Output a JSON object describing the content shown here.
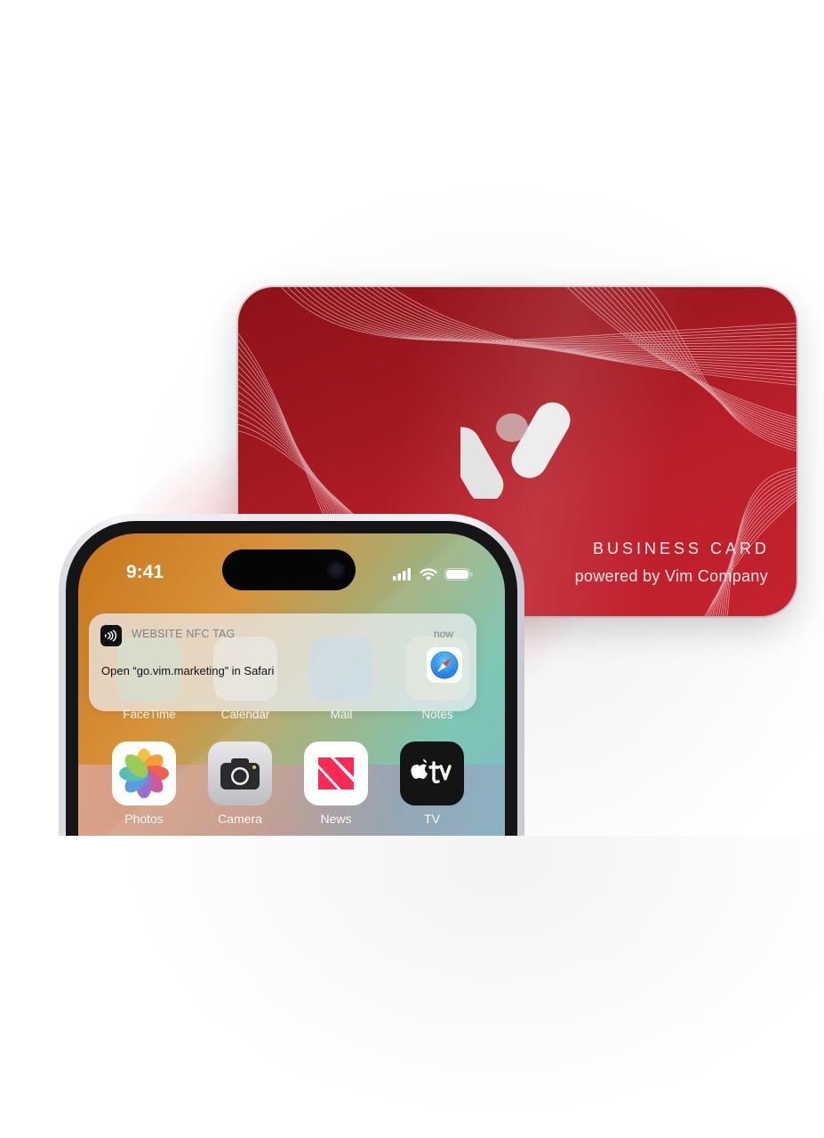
{
  "card": {
    "title": "BUSINESS CARD",
    "subtitle": "powered by Vim Company",
    "colors": {
      "base": "#a51a23",
      "logo": "#e0e0e0"
    }
  },
  "phone": {
    "status": {
      "time": "9:41"
    },
    "notification": {
      "app_name": "WEBSITE NFC TAG",
      "time": "now",
      "message": "Open “go.vim.marketing” in Safari",
      "app_icon": "nfc-icon",
      "action_icon": "safari-icon"
    },
    "background_apps": [
      {
        "label": "FaceTime",
        "icon": "facetime-icon"
      },
      {
        "label": "Calendar",
        "icon": "calendar-icon"
      },
      {
        "label": "Mail",
        "icon": "mail-icon"
      },
      {
        "label": "Notes",
        "icon": "notes-icon"
      }
    ],
    "apps": [
      {
        "label": "Photos",
        "icon": "photos-icon"
      },
      {
        "label": "Camera",
        "icon": "camera-icon"
      },
      {
        "label": "News",
        "icon": "news-icon"
      },
      {
        "label": "TV",
        "icon": "tv-icon"
      }
    ]
  }
}
